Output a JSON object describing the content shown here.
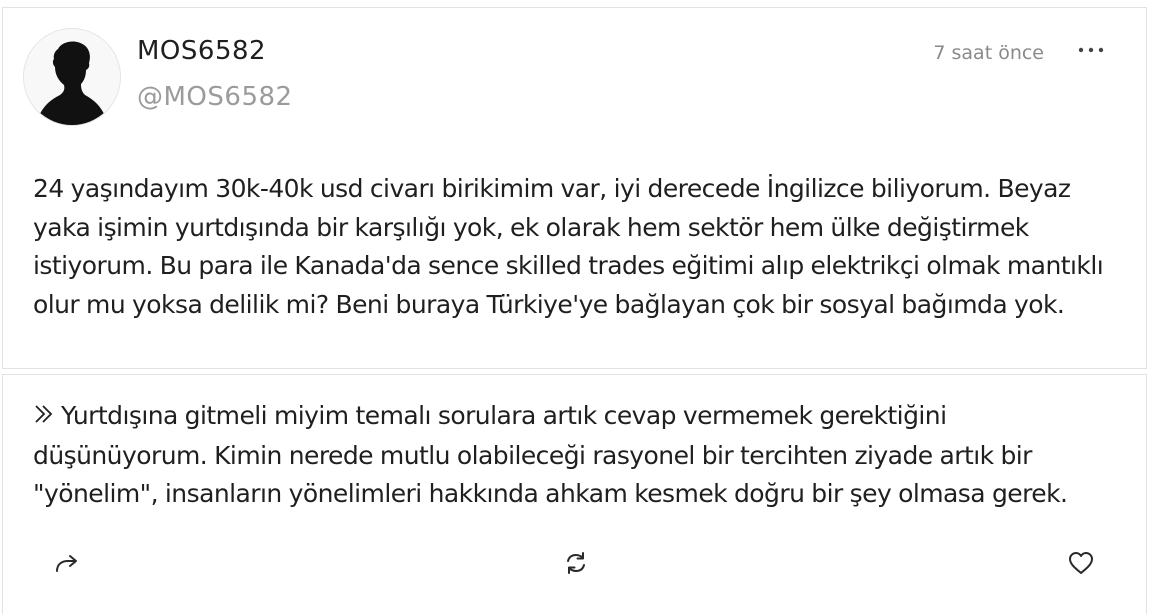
{
  "post": {
    "author": {
      "display_name": "MOS6582",
      "handle": "@MOS6582",
      "avatar_icon": "silhouette-avatar-icon"
    },
    "timestamp": "7 saat önce",
    "more_icon": "more-horizontal-icon",
    "question_text": "24 yaşındayım 30k-40k usd civarı birikimim var, iyi derecede İngilizce biliyorum. Beyaz yaka işimin yurtdışında bir karşılığı yok, ek olarak hem sektör hem ülke değiştirmek istiyorum. Bu para ile Kanada'da sence skilled trades eğitimi alıp elektrikçi olmak mantıklı olur mu yoksa delilik mi? Beni buraya Türkiye'ye bağlayan çok bir sosyal bağımda yok."
  },
  "answer": {
    "quote_icon": "double-chevron-right-icon",
    "text": "Yurtdışına gitmeli miyim temalı sorulara artık cevap vermemek gerektiğini düşünüyorum. Kimin nerede mutlu olabileceği rasyonel bir tercihten ziyade artık bir \"yönelim\", insanların yönelimleri hakkında ahkam kesmek doğru bir şey olmasa gerek."
  },
  "actions": {
    "share_icon": "share-icon",
    "repost_icon": "repost-icon",
    "like_icon": "heart-icon"
  },
  "colors": {
    "text": "#1f1f1f",
    "muted": "#9b9b9b",
    "border": "#e2e2e2"
  }
}
